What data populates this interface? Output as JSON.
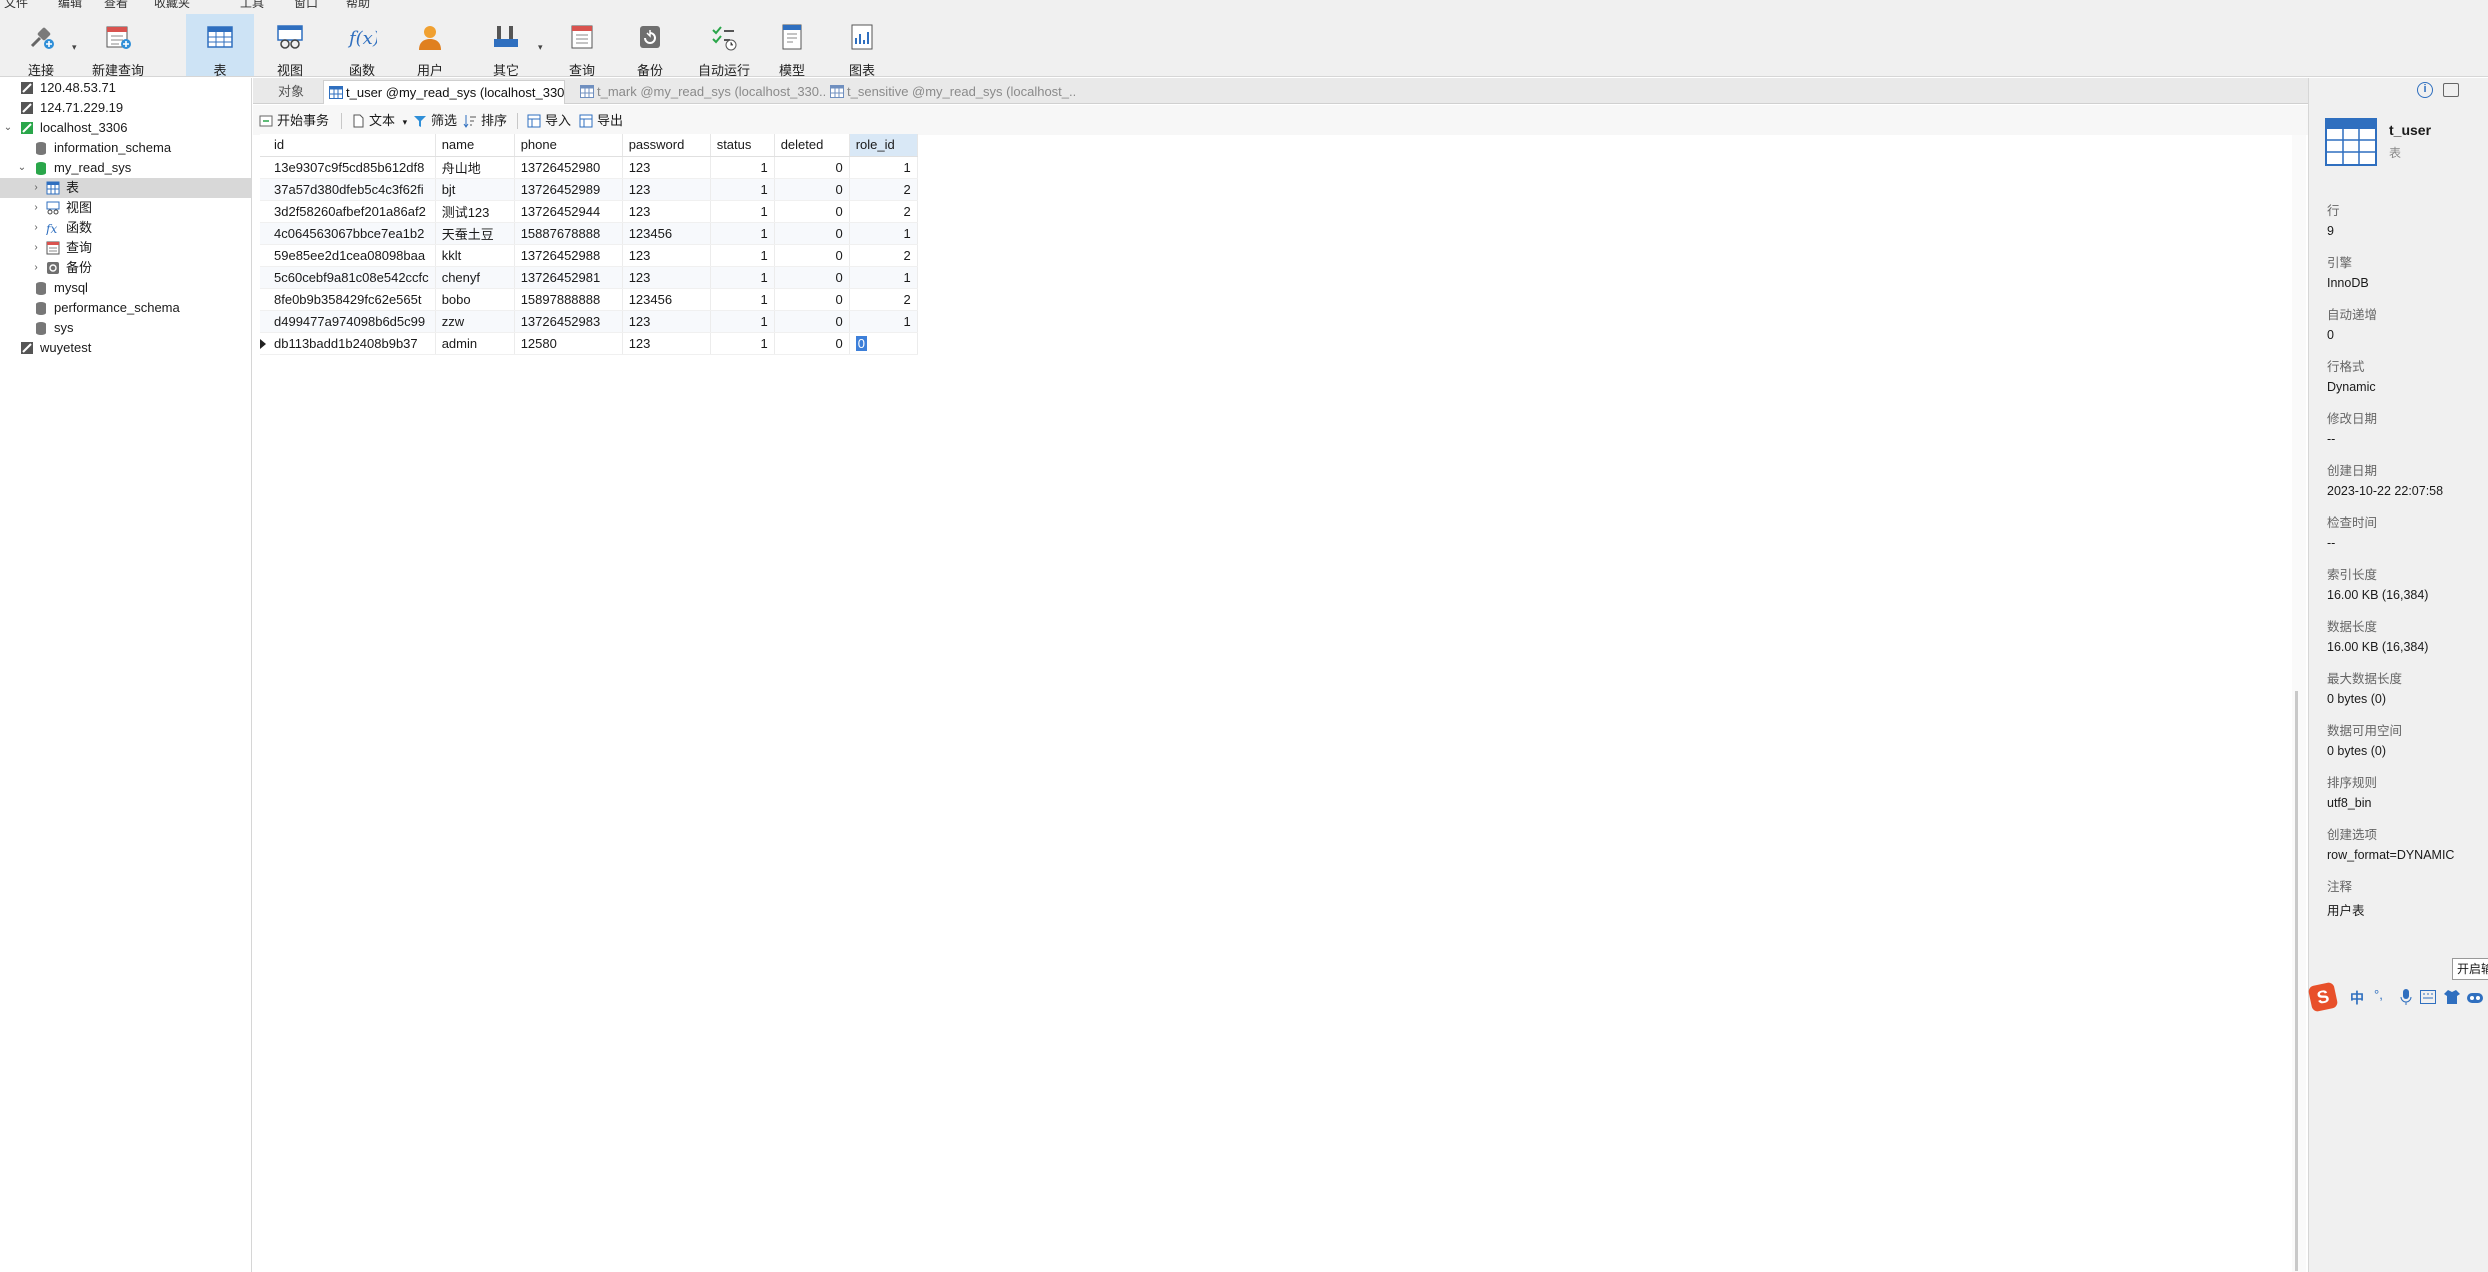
{
  "menu": [
    "文件",
    "编辑",
    "查看",
    "收藏夹",
    "工具",
    "窗口",
    "帮助"
  ],
  "toolbar": {
    "connect": "连接",
    "new_query": "新建查询",
    "table": "表",
    "view": "视图",
    "function": "函数",
    "user": "用户",
    "other": "其它",
    "query": "查询",
    "backup": "备份",
    "autorun": "自动运行",
    "model": "模型",
    "chart": "图表"
  },
  "nav": {
    "items": [
      {
        "label": "120.48.53.71"
      },
      {
        "label": "124.71.229.19"
      },
      {
        "label": "localhost_3306"
      },
      {
        "label": "information_schema"
      },
      {
        "label": "my_read_sys"
      },
      {
        "label": "表"
      },
      {
        "label": "视图"
      },
      {
        "label": "函数"
      },
      {
        "label": "查询"
      },
      {
        "label": "备份"
      },
      {
        "label": "mysql"
      },
      {
        "label": "performance_schema"
      },
      {
        "label": "sys"
      },
      {
        "label": "wuyetest"
      }
    ]
  },
  "tabs": {
    "objects": "对象",
    "t_user": "t_user @my_read_sys (localhost_330...",
    "t_mark": "t_mark @my_read_sys (localhost_330...",
    "t_sensitive": "t_sensitive @my_read_sys (localhost_..."
  },
  "gridbar": {
    "begin_tx": "开始事务",
    "text": "文本",
    "filter": "筛选",
    "sort": "排序",
    "import": "导入",
    "export": "导出"
  },
  "grid": {
    "columns": [
      "id",
      "name",
      "phone",
      "password",
      "status",
      "deleted",
      "role_id"
    ],
    "rows": [
      [
        "13e9307c9f5cd85b612df8",
        "舟山地",
        "13726452980",
        "123",
        "1",
        "0",
        "1"
      ],
      [
        "37a57d380dfeb5c4c3f62fi",
        "bjt",
        "13726452989",
        "123",
        "1",
        "0",
        "2"
      ],
      [
        "3d2f58260afbef201a86af2",
        "测试123",
        "13726452944",
        "123",
        "1",
        "0",
        "2"
      ],
      [
        "4c064563067bbce7ea1b2",
        "天蚕土豆",
        "15887678888",
        "123456",
        "1",
        "0",
        "1"
      ],
      [
        "59e85ee2d1cea08098baa",
        "kklt",
        "13726452988",
        "123",
        "1",
        "0",
        "2"
      ],
      [
        "5c60cebf9a81c08e542ccfc",
        "chenyf",
        "13726452981",
        "123",
        "1",
        "0",
        "1"
      ],
      [
        "8fe0b9b358429fc62e565t",
        "bobo",
        "15897888888",
        "123456",
        "1",
        "0",
        "2"
      ],
      [
        "d499477a974098b6d5c99",
        "zzw",
        "13726452983",
        "123",
        "1",
        "0",
        "1"
      ],
      [
        "db113badd1b2408b9b37",
        "admin",
        "12580",
        "123",
        "1",
        "0",
        "0"
      ]
    ]
  },
  "info": {
    "title": "t_user",
    "subtitle": "表",
    "props": [
      {
        "k": "行",
        "v": "9"
      },
      {
        "k": "引擎",
        "v": "InnoDB"
      },
      {
        "k": "自动递增",
        "v": "0"
      },
      {
        "k": "行格式",
        "v": "Dynamic"
      },
      {
        "k": "修改日期",
        "v": "--"
      },
      {
        "k": "创建日期",
        "v": "2023-10-22 22:07:58"
      },
      {
        "k": "检查时间",
        "v": "--"
      },
      {
        "k": "索引长度",
        "v": "16.00 KB (16,384)"
      },
      {
        "k": "数据长度",
        "v": "16.00 KB (16,384)"
      },
      {
        "k": "最大数据长度",
        "v": "0 bytes (0)"
      },
      {
        "k": "数据可用空间",
        "v": "0 bytes (0)"
      },
      {
        "k": "排序规则",
        "v": "utf8_bin"
      },
      {
        "k": "创建选项",
        "v": "row_format=DYNAMIC"
      },
      {
        "k": "注释",
        "v": "用户表"
      }
    ],
    "tooltip": "开启输入"
  },
  "ime": {
    "mode": "中"
  }
}
